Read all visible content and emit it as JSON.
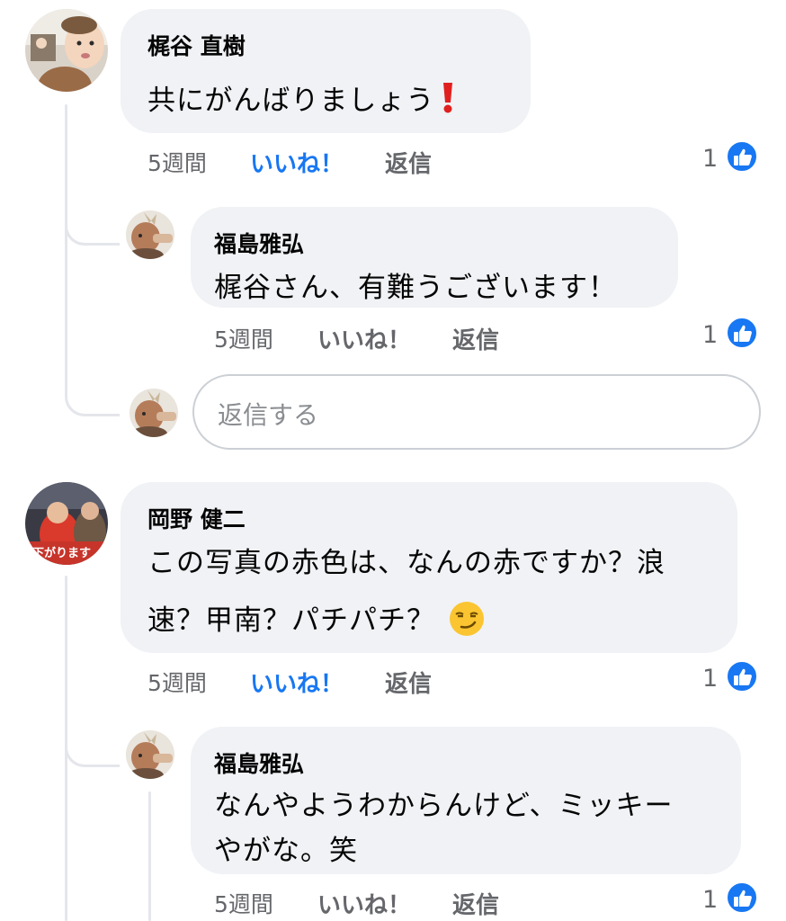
{
  "comments": [
    {
      "author": "梶谷 直樹",
      "text": "共にがんばりましょう",
      "emoji": "red-exclamation-emoji",
      "time": "5週間",
      "like_label": "いいね！",
      "like_active": true,
      "reply_label": "返信",
      "like_count": "1",
      "replies": [
        {
          "author": "福島雅弘",
          "text": "梶谷さん、有難うございます！",
          "time": "5週間",
          "like_label": "いいね！",
          "like_active": false,
          "reply_label": "返信",
          "like_count": "1"
        }
      ],
      "reply_input": {
        "placeholder": "返信する"
      }
    },
    {
      "author": "岡野 健二",
      "text_line1": "この写真の赤色は、なんの赤ですか？浪",
      "text_line2": "速？甲南？パチパチ？",
      "emoji": "smirk-face-emoji",
      "avatar_overlay_text": "下がります",
      "time": "5週間",
      "like_label": "いいね！",
      "like_active": true,
      "reply_label": "返信",
      "like_count": "1",
      "replies": [
        {
          "author": "福島雅弘",
          "text_line1": "なんやようわからんけど、ミッキー",
          "text_line2": "やがな。笑",
          "time": "5週間",
          "like_label": "いいね！",
          "like_active": false,
          "reply_label": "返信",
          "like_count": "1"
        }
      ]
    }
  ],
  "colors": {
    "bubble": "#f0f2f5",
    "like_blue": "#1877f2",
    "meta_gray": "#65676b",
    "thread_line": "#e4e6eb"
  }
}
